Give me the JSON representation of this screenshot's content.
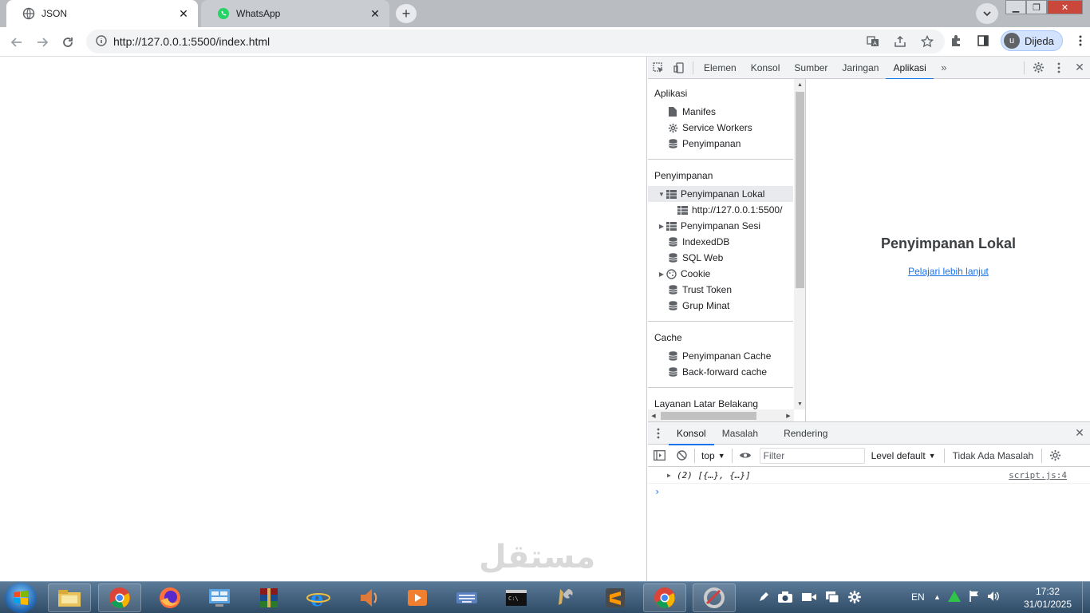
{
  "browser": {
    "tabs": [
      {
        "title": "JSON",
        "active": true
      },
      {
        "title": "WhatsApp",
        "active": false
      }
    ],
    "url": "http://127.0.0.1:5500/index.html",
    "profile": {
      "initial": "u",
      "name": "Dijeda"
    }
  },
  "devtools": {
    "tabs": [
      "Elemen",
      "Konsol",
      "Sumber",
      "Jaringan",
      "Aplikasi"
    ],
    "active_tab": "Aplikasi",
    "sidebar": {
      "section_app": "Aplikasi",
      "app_items": [
        "Manifes",
        "Service Workers",
        "Penyimpanan"
      ],
      "section_storage": "Penyimpanan",
      "storage_items": [
        "Penyimpanan Lokal",
        "http://127.0.0.1:5500/",
        "Penyimpanan Sesi",
        "IndexedDB",
        "SQL Web",
        "Cookie",
        "Trust Token",
        "Grup Minat"
      ],
      "section_cache": "Cache",
      "cache_items": [
        "Penyimpanan Cache",
        "Back-forward cache"
      ],
      "section_bg": "Layanan Latar Belakang"
    },
    "main": {
      "heading": "Penyimpanan Lokal",
      "link": "Pelajari lebih lanjut"
    },
    "drawer": {
      "tabs": [
        "Konsol",
        "Masalah",
        "Rendering"
      ],
      "context": "top",
      "filter_placeholder": "Filter",
      "levels": "Level default",
      "issues": "Tidak Ada Masalah",
      "log_message": "(2) [{…}, {…}]",
      "log_source": "script.js:4",
      "prompt": "›"
    }
  },
  "taskbar": {
    "lang": "EN",
    "time": "17:32",
    "date": "31/01/2025"
  },
  "watermark": "مستقل"
}
